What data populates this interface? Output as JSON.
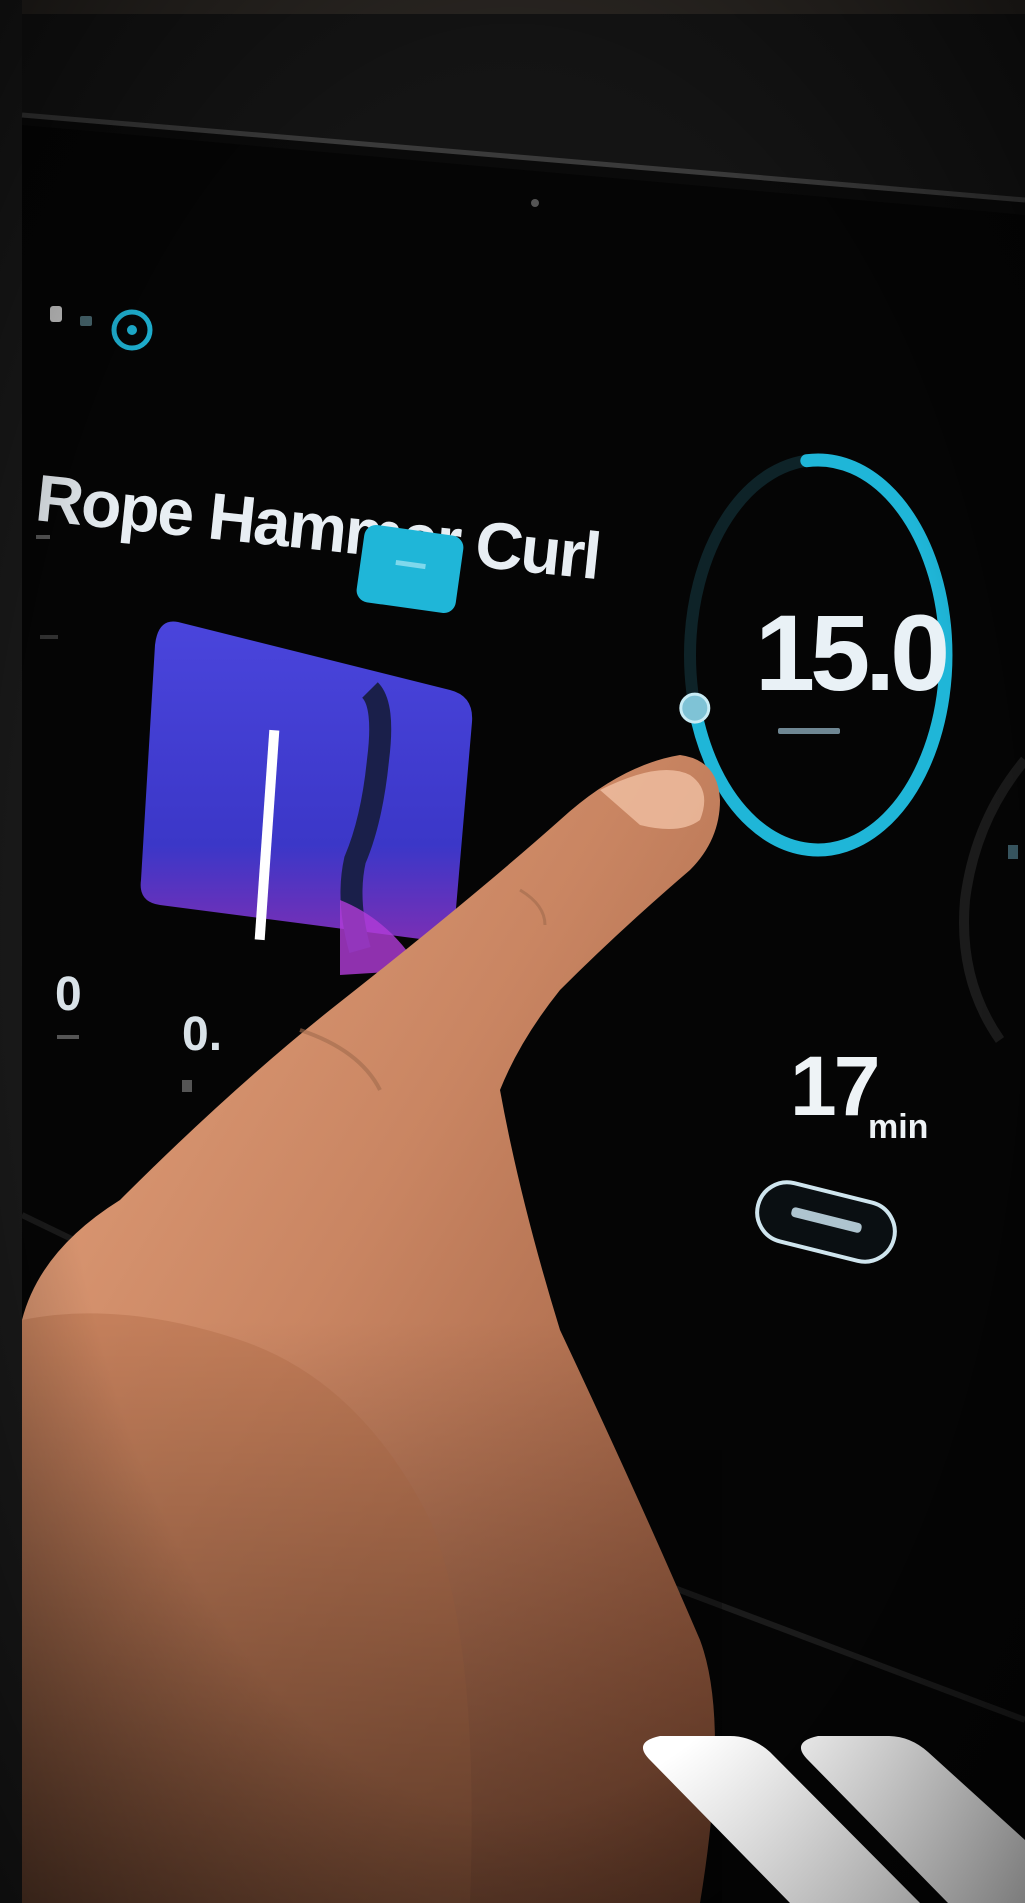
{
  "exercise": {
    "title": "Rope Hammer Curl",
    "weight_value": "15.0",
    "weight_progress": 0.72,
    "duration_value": "17",
    "duration_unit": "min"
  },
  "stats": [
    {
      "value": "0"
    },
    {
      "value": "0."
    }
  ],
  "colors": {
    "accent": "#1fb6d8",
    "preview_bg": "#3f3bd0",
    "screen_bg": "#050505"
  }
}
